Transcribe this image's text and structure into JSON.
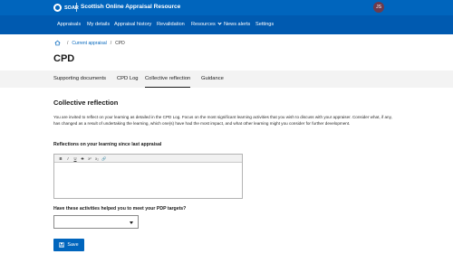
{
  "header": {
    "logo_text": "SOAR",
    "site_title": "Scottish Online Appraisal Resource",
    "avatar_initials": "JS",
    "avatar_color": "#6d3b4d",
    "brand_color": "#0065bd"
  },
  "nav": {
    "items": [
      {
        "label": "Appraisals"
      },
      {
        "label": "My details"
      },
      {
        "label": "Appraisal history"
      },
      {
        "label": "Revalidation"
      },
      {
        "label": "Resources"
      },
      {
        "label": "News alerts"
      },
      {
        "label": "Settings"
      }
    ]
  },
  "breadcrumb": {
    "home_icon": "home-icon",
    "items": [
      "Current appraisal",
      "CPD"
    ]
  },
  "page": {
    "title": "CPD"
  },
  "tabs": [
    {
      "label": "Supporting documents",
      "active": false
    },
    {
      "label": "CPD Log",
      "active": false
    },
    {
      "label": "Collective reflection",
      "active": true
    },
    {
      "label": "Guidance",
      "active": false
    }
  ],
  "content": {
    "section_title": "Collective reflection",
    "intro": "You are invited to reflect on your learning as detailed in the CPD Log.  Focus on the most significant learning activities that you wish to discuss with your appraiser. Consider what, if any, has changed as a result of undertaking the learning, which one(s) have had the most impact, and what other learning might you consider for further development.",
    "reflection_label": "Reflections on your learning since last appraisal",
    "reflection_value": "",
    "editor_toolbar": [
      "B",
      "I",
      "U",
      "S",
      "x²",
      "x₂",
      "🔗"
    ],
    "pdp_label": "Have these activities helped you to meet your PDP targets?",
    "pdp_selected": "",
    "save_label": "Save"
  }
}
